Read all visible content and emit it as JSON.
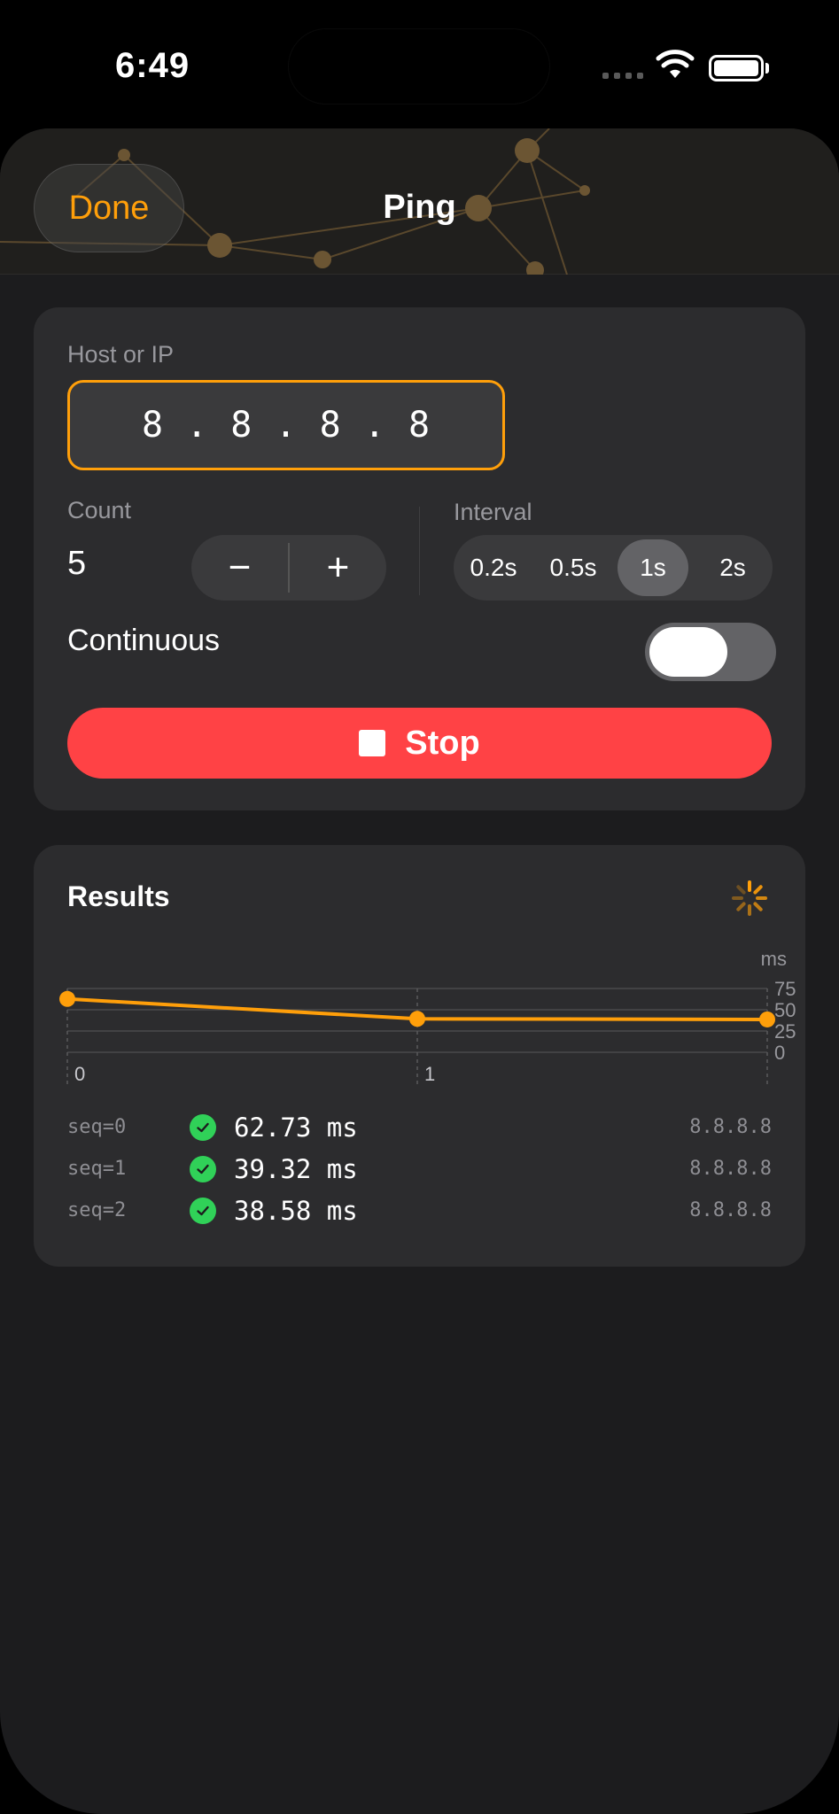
{
  "status": {
    "time": "6:49"
  },
  "nav": {
    "done_label": "Done",
    "title": "Ping"
  },
  "config": {
    "host_label": "Host or IP",
    "host_value": "8 . 8 . 8 . 8",
    "count_label": "Count",
    "count_value": "5",
    "decrement_symbol": "−",
    "increment_symbol": "+",
    "interval_label": "Interval",
    "interval_options": [
      "0.2s",
      "0.5s",
      "1s",
      "2s"
    ],
    "interval_selected": "1s",
    "continuous_label": "Continuous",
    "continuous_on": false,
    "stop_label": "Stop"
  },
  "results": {
    "title": "Results",
    "rows": [
      {
        "seq": "seq=0",
        "time": "62.73 ms",
        "host": "8.8.8.8"
      },
      {
        "seq": "seq=1",
        "time": "39.32 ms",
        "host": "8.8.8.8"
      },
      {
        "seq": "seq=2",
        "time": "38.58 ms",
        "host": "8.8.8.8"
      }
    ]
  },
  "chart_data": {
    "type": "line",
    "x": [
      0,
      1,
      2
    ],
    "values": [
      62.73,
      39.32,
      38.58
    ],
    "x_tick_labels": [
      "0",
      "1"
    ],
    "y_ticks": [
      0,
      25,
      50,
      75
    ],
    "ylabel": "ms",
    "ylim": [
      0,
      75
    ],
    "xlim": [
      0,
      2
    ],
    "grid": true,
    "colors": {
      "line": "#ff9f0a",
      "grid": "#4a4a4c"
    }
  },
  "colors": {
    "accent": "#ff9f0a",
    "danger": "#ff4245",
    "success": "#30d158"
  }
}
